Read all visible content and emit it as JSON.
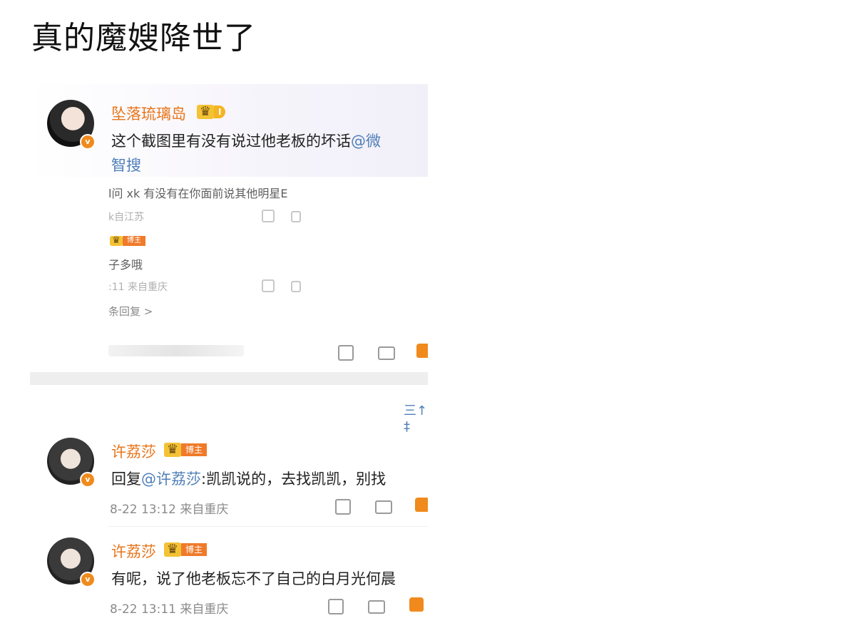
{
  "post": {
    "title": "真的魔嫂降世了"
  },
  "comment_main": {
    "username": "坠落琉璃岛",
    "badge": "I",
    "text_line1": "这个截图里有没有说过他老板的坏话",
    "mention": "@微",
    "text_line2": "智搜"
  },
  "quoted": {
    "line1": "l问 xk 有没有在你面前说其他明星E",
    "meta1": "k自江苏",
    "badge2": "博主",
    "line2": "子多哦",
    "meta2": ":11 来自重庆",
    "more_replies": "条回复 >"
  },
  "sort_label": "三↑ ‡",
  "reply1": {
    "username": "许荔莎",
    "badge": "博主",
    "prefix": "回复",
    "mention": "@许荔莎",
    "text": ":凯凯说的，去找凯凯，别找",
    "meta": "8-22 13:12 来自重庆"
  },
  "reply2": {
    "username": "许荔莎",
    "badge": "博主",
    "text": "有呢，说了他老板忘不了自己的白月光何晨",
    "meta": "8-22 13:11 来自重庆"
  },
  "icons": {
    "verified": "verified-badge-icon",
    "crown": "crown-icon",
    "share": "share-icon",
    "comment": "comment-icon",
    "like": "like-icon"
  },
  "colors": {
    "username": "#e8751a",
    "mention": "#4f7fb8",
    "meta": "#8a8a8a",
    "badge": "#f08a1c"
  }
}
